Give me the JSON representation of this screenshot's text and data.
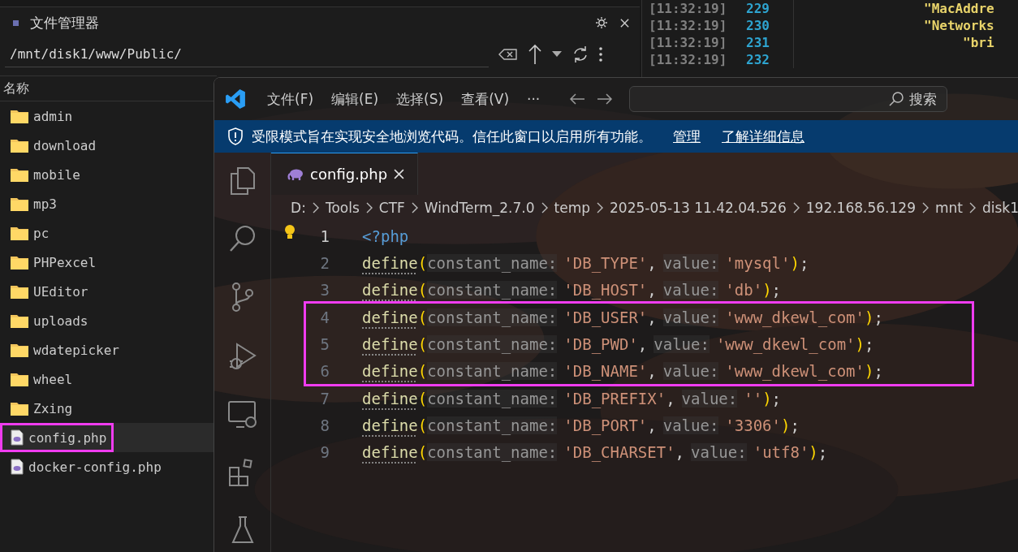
{
  "file_manager": {
    "title": "文件管理器",
    "path": "/mnt/disk1/www/Public/",
    "column_header": "名称",
    "items": [
      {
        "kind": "folder",
        "name": "admin",
        "selected": false,
        "highlighted": false
      },
      {
        "kind": "folder",
        "name": "download",
        "selected": false,
        "highlighted": false
      },
      {
        "kind": "folder",
        "name": "mobile",
        "selected": false,
        "highlighted": false
      },
      {
        "kind": "folder",
        "name": "mp3",
        "selected": false,
        "highlighted": false
      },
      {
        "kind": "folder",
        "name": "pc",
        "selected": false,
        "highlighted": false
      },
      {
        "kind": "folder",
        "name": "PHPexcel",
        "selected": false,
        "highlighted": false
      },
      {
        "kind": "folder",
        "name": "UEditor",
        "selected": false,
        "highlighted": false
      },
      {
        "kind": "folder",
        "name": "uploads",
        "selected": false,
        "highlighted": false
      },
      {
        "kind": "folder",
        "name": "wdatepicker",
        "selected": false,
        "highlighted": false
      },
      {
        "kind": "folder",
        "name": "wheel",
        "selected": false,
        "highlighted": false
      },
      {
        "kind": "folder",
        "name": "Zxing",
        "selected": false,
        "highlighted": false
      },
      {
        "kind": "php",
        "name": "config.php",
        "selected": true,
        "highlighted": true
      },
      {
        "kind": "php",
        "name": "docker-config.php",
        "selected": false,
        "highlighted": false
      }
    ]
  },
  "terminal": {
    "lines": [
      {
        "time": "[11:32:19]",
        "number": "229",
        "text": "\"MacAddre"
      },
      {
        "time": "[11:32:19]",
        "number": "230",
        "text": "\"Networks",
        "children": [
          {
            "time": "[11:32:19]",
            "number": "231",
            "text": "\"bri"
          }
        ]
      },
      {
        "time": "[11:32:19]",
        "number": "232"
      }
    ]
  },
  "editor": {
    "menu": [
      "文件(F)",
      "编辑(E)",
      "选择(S)",
      "查看(V)",
      "···"
    ],
    "search_placeholder": "搜索",
    "banner": {
      "text": "受限模式旨在实现安全地浏览代码。信任此窗口以启用所有功能。",
      "links": [
        "管理",
        "了解详细信息"
      ]
    },
    "tabs": [
      {
        "name": "config.php",
        "selected": true
      }
    ],
    "breadcrumb": [
      "D:",
      "Tools",
      "CTF",
      "WindTerm_2.7.0",
      "temp",
      "2025-05-13 11.42.04.526",
      "192.168.56.129",
      "mnt",
      "disk1"
    ],
    "lines": [
      {
        "number": "1",
        "highlighted": false,
        "tokens": [
          {
            "kind": "tag",
            "text": "<?php"
          }
        ]
      },
      {
        "number": "2",
        "highlighted": false,
        "tokens": [
          {
            "kind": "func",
            "text": "define"
          },
          {
            "kind": "paren",
            "text": "("
          },
          {
            "kind": "hint",
            "text": "constant_name:"
          },
          {
            "kind": "string",
            "text": "'DB_TYPE'"
          },
          {
            "kind": "punct",
            "text": ","
          },
          {
            "kind": "hint",
            "text": "value:"
          },
          {
            "kind": "string",
            "text": "'mysql'"
          },
          {
            "kind": "paren",
            "text": ")"
          },
          {
            "kind": "punct",
            "text": ";"
          }
        ]
      },
      {
        "number": "3",
        "highlighted": false,
        "tokens": [
          {
            "kind": "func",
            "text": "define"
          },
          {
            "kind": "paren",
            "text": "("
          },
          {
            "kind": "hint",
            "text": "constant_name:"
          },
          {
            "kind": "string",
            "text": "'DB_HOST'"
          },
          {
            "kind": "punct",
            "text": ","
          },
          {
            "kind": "hint",
            "text": "value:"
          },
          {
            "kind": "string",
            "text": "'db'"
          },
          {
            "kind": "paren",
            "text": ")"
          },
          {
            "kind": "punct",
            "text": ";"
          }
        ]
      },
      {
        "number": "4",
        "highlighted": true,
        "tokens": [
          {
            "kind": "func",
            "text": "define"
          },
          {
            "kind": "paren",
            "text": "("
          },
          {
            "kind": "hint",
            "text": "constant_name:"
          },
          {
            "kind": "string",
            "text": "'DB_USER'"
          },
          {
            "kind": "punct",
            "text": ","
          },
          {
            "kind": "hint",
            "text": "value:"
          },
          {
            "kind": "string",
            "text": "'www_dkewl_com'"
          },
          {
            "kind": "paren",
            "text": ")"
          },
          {
            "kind": "punct",
            "text": ";"
          }
        ]
      },
      {
        "number": "5",
        "highlighted": true,
        "tokens": [
          {
            "kind": "func",
            "text": "define"
          },
          {
            "kind": "paren",
            "text": "("
          },
          {
            "kind": "hint",
            "text": "constant_name:"
          },
          {
            "kind": "string",
            "text": "'DB_PWD'"
          },
          {
            "kind": "punct",
            "text": ","
          },
          {
            "kind": "hint",
            "text": "value:"
          },
          {
            "kind": "string",
            "text": "'www_dkewl_com'"
          },
          {
            "kind": "paren",
            "text": ")"
          },
          {
            "kind": "punct",
            "text": ";"
          }
        ]
      },
      {
        "number": "6",
        "highlighted": true,
        "tokens": [
          {
            "kind": "func",
            "text": "define"
          },
          {
            "kind": "paren",
            "text": "("
          },
          {
            "kind": "hint",
            "text": "constant_name:"
          },
          {
            "kind": "string",
            "text": "'DB_NAME'"
          },
          {
            "kind": "punct",
            "text": ","
          },
          {
            "kind": "hint",
            "text": "value:"
          },
          {
            "kind": "string",
            "text": "'www_dkewl_com'"
          },
          {
            "kind": "paren",
            "text": ")"
          },
          {
            "kind": "punct",
            "text": ";"
          }
        ]
      },
      {
        "number": "7",
        "highlighted": false,
        "tokens": [
          {
            "kind": "func",
            "text": "define"
          },
          {
            "kind": "paren",
            "text": "("
          },
          {
            "kind": "hint",
            "text": "constant_name:"
          },
          {
            "kind": "string",
            "text": "'DB_PREFIX'"
          },
          {
            "kind": "punct",
            "text": ","
          },
          {
            "kind": "hint",
            "text": "value:"
          },
          {
            "kind": "string",
            "text": "''"
          },
          {
            "kind": "paren",
            "text": ")"
          },
          {
            "kind": "punct",
            "text": ";"
          }
        ]
      },
      {
        "number": "8",
        "highlighted": false,
        "tokens": [
          {
            "kind": "func",
            "text": "define"
          },
          {
            "kind": "paren",
            "text": "("
          },
          {
            "kind": "hint",
            "text": "constant_name:"
          },
          {
            "kind": "string",
            "text": "'DB_PORT'"
          },
          {
            "kind": "punct",
            "text": ","
          },
          {
            "kind": "hint",
            "text": "value:"
          },
          {
            "kind": "string",
            "text": "'3306'"
          },
          {
            "kind": "paren",
            "text": ")"
          },
          {
            "kind": "punct",
            "text": ";"
          }
        ]
      },
      {
        "number": "9",
        "highlighted": false,
        "tokens": [
          {
            "kind": "func",
            "text": "define"
          },
          {
            "kind": "paren",
            "text": "("
          },
          {
            "kind": "hint",
            "text": "constant_name:"
          },
          {
            "kind": "string",
            "text": "'DB_CHARSET'"
          },
          {
            "kind": "punct",
            "text": ","
          },
          {
            "kind": "hint",
            "text": "value:"
          },
          {
            "kind": "string",
            "text": "'utf8'"
          },
          {
            "kind": "paren",
            "text": ")"
          },
          {
            "kind": "punct",
            "text": ";"
          }
        ]
      }
    ]
  }
}
